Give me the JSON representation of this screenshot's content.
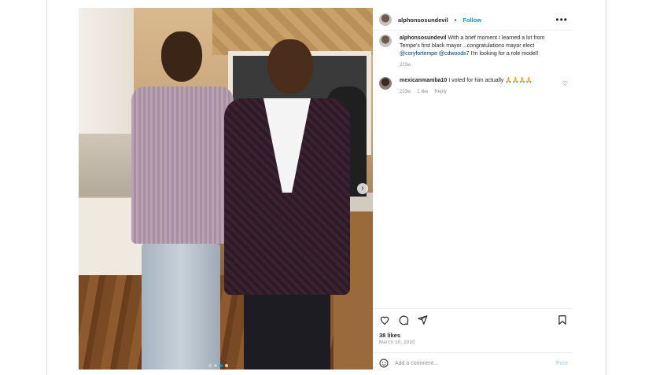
{
  "post": {
    "username": "alphonsosundevil",
    "separator": "•",
    "follow_label": "Follow",
    "more_label": "•••"
  },
  "caption": {
    "username": "alphonsosundevil",
    "text": "With a brief moment I learned a lot from Tempe's first black mayor…congratulations mayor elect",
    "mention1": "@coryfortempe",
    "mention2": "@cdwoods7",
    "text_end": "I'm looking for a role model!",
    "age": "223w"
  },
  "comments": [
    {
      "username": "mexicanmamba10",
      "text": "I voted for him actually 🙏🙏🙏🙏",
      "age": "223w",
      "likes": "1 like",
      "reply": "Reply"
    }
  ],
  "likes": "38 likes",
  "date": "March 10, 2020",
  "add_comment": {
    "placeholder": "Add a comment...",
    "post_label": "Post"
  },
  "carousel": {
    "next": "›",
    "dots": 4,
    "active_dot": 2
  },
  "colors": {
    "link": "#0095f6",
    "mention": "#00376b",
    "muted": "#8e8e8e"
  },
  "icons": [
    "heart-icon",
    "comment-icon",
    "share-icon",
    "bookmark-icon",
    "emoji-icon",
    "more-icon"
  ]
}
